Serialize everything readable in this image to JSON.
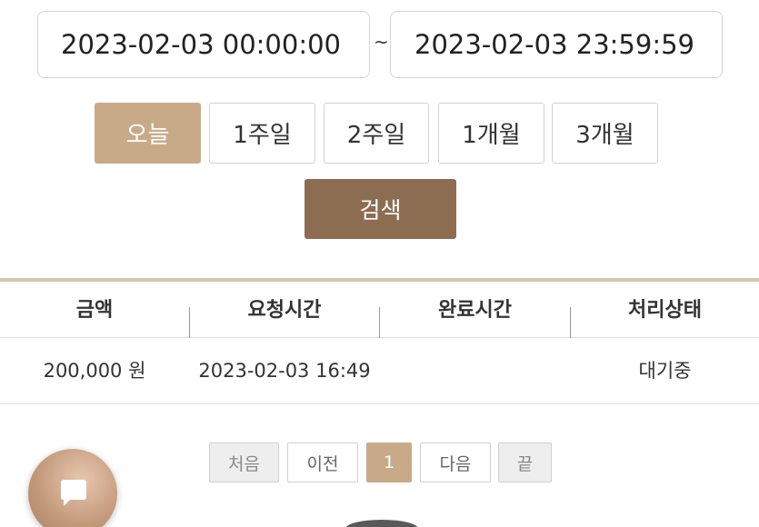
{
  "date_range": {
    "start": "2023-02-03 00:00:00",
    "separator": "~",
    "end": "2023-02-03 23:59:59"
  },
  "period_buttons": [
    {
      "label": "오늘",
      "active": true
    },
    {
      "label": "1주일",
      "active": false
    },
    {
      "label": "2주일",
      "active": false
    },
    {
      "label": "1개월",
      "active": false
    },
    {
      "label": "3개월",
      "active": false
    }
  ],
  "search": {
    "label": "검색"
  },
  "table": {
    "headers": [
      "금액",
      "요청시간",
      "완료시간",
      "처리상태"
    ],
    "rows": [
      [
        "200,000 원",
        "2023-02-03 16:49",
        "",
        "대기중"
      ]
    ]
  },
  "pagination": {
    "first": "처음",
    "prev": "이전",
    "current": "1",
    "next": "다음",
    "last": "끝"
  },
  "colors": {
    "accent": "#c9aa88",
    "search_button": "#8d6d52",
    "header_border": "#d8c6b1"
  },
  "chat_button": {
    "icon": "chat-bubble-icon"
  }
}
